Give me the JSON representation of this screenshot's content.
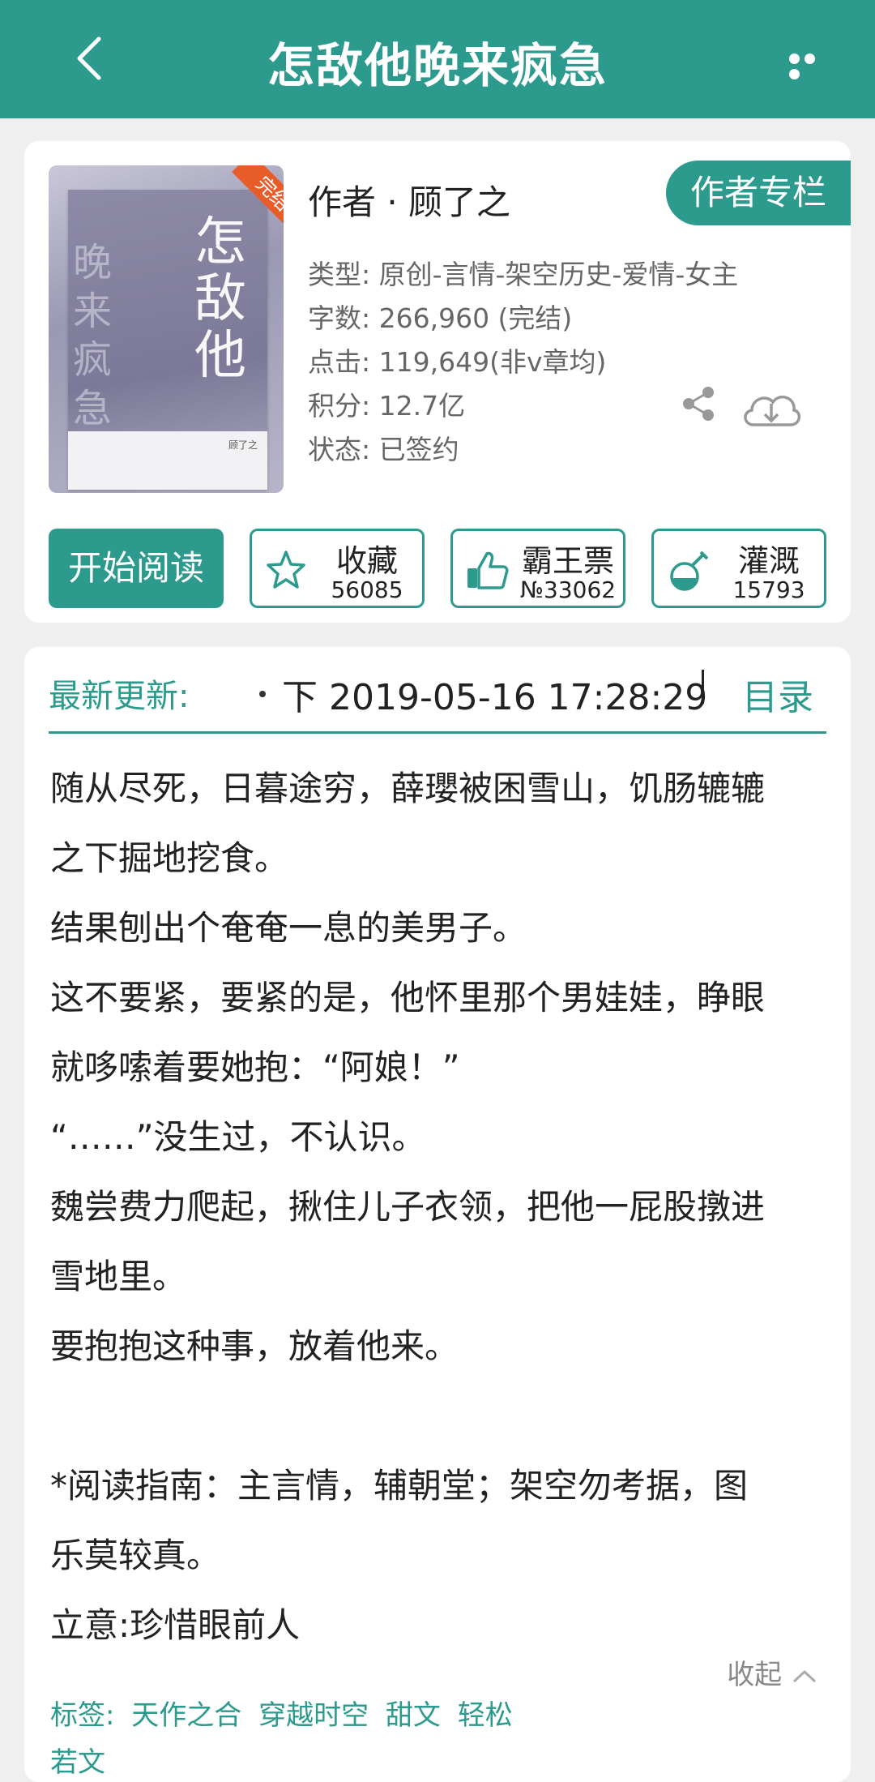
{
  "header": {
    "title": "怎敌他晚来疯急"
  },
  "book": {
    "cover": {
      "ribbon": "完结",
      "title_chars": "怎敌他",
      "sub_chars": "晚来疯急",
      "author_small": "顾了之"
    },
    "author_line": "作者 · 顾了之",
    "author_column_label": "作者专栏",
    "type": "类型: 原创-言情-架空历史-爱情-女主",
    "words": "字数: 266,960 (完结)",
    "clicks": "点击: 119,649(非v章均)",
    "score": "积分: 12.7亿",
    "status": "状态: 已签约"
  },
  "actions": {
    "read_label": "开始阅读",
    "favorite": {
      "label": "收藏",
      "count": "56085"
    },
    "bawang": {
      "label": "霸王票",
      "count": "№33062"
    },
    "irrigate": {
      "label": "灌溉",
      "count": "15793"
    }
  },
  "update": {
    "label": "最新更新:",
    "text": "下  2019-05-16 17:28:29",
    "toc_label": "目录"
  },
  "intro": [
    "随从尽死，日暮途穷，薛瓔被困雪山，饥肠辘辘",
    "之下掘地挖食。",
    "结果刨出个奄奄一息的美男子。",
    "这不要紧，要紧的是，他怀里那个男娃娃，睁眼",
    "就哆嗦着要她抱：“阿娘！”",
    "“……”没生过，不认识。",
    "魏尝费力爬起，揪住儿子衣领，把他一屁股撴进",
    "雪地里。",
    "要抱抱这种事，放着他来。",
    "",
    "*阅读指南：主言情，辅朝堂；架空勿考据，图",
    "乐莫较真。",
    "立意:珍惜眼前人"
  ],
  "collapse_label": "收起",
  "tags": {
    "label": "标签:",
    "items": [
      "天作之合",
      "穿越时空",
      "甜文",
      "轻松"
    ],
    "next_line_partial": "若文"
  }
}
